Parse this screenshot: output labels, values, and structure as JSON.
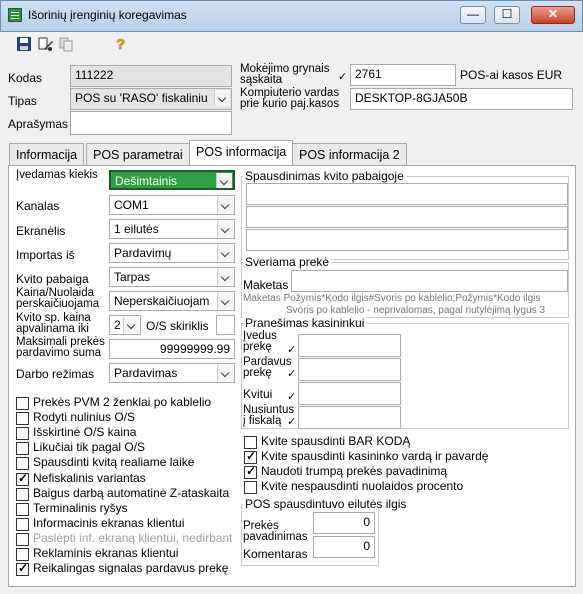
{
  "window": {
    "title": "Išorinių įrenginių koregavimas",
    "btn_min": "—",
    "btn_max": "☐",
    "btn_close": "✕"
  },
  "toolbar": {
    "save_icon": "floppy-disk-icon",
    "edit_icon": "edit-icon",
    "copy_icon": "copy-icon",
    "help_icon": "help-icon",
    "help_glyph": "?"
  },
  "header": {
    "kodas_label": "Kodas",
    "kodas_value": "111222",
    "tipas_label": "Tipas",
    "tipas_value": "POS su 'RASO' fiskaliniu",
    "aprasymas_label": "Aprašymas",
    "aprasymas_value": "",
    "mokejimo_label": "Mokėjimo grynais sąskaita",
    "mokejimo_value": "2761",
    "mokejimo_suffix": "POS-ai kasos EUR",
    "kompiuterio_label": "Kompiuterio vardas prie kurio paj.kasos",
    "kompiuterio_value": "DESKTOP-8GJA50B",
    "check_mark": "✓"
  },
  "tabs": [
    {
      "label": "Informacija"
    },
    {
      "label": "POS parametrai"
    },
    {
      "label": "POS informacija"
    },
    {
      "label": "POS informacija 2"
    }
  ],
  "left": {
    "ivedamas_label": "Įvedamas kiekis",
    "ivedamas_value": "Dešimtainis",
    "kanalas_label": "Kanalas",
    "kanalas_value": "COM1",
    "ekranelis_label": "Ekranėlis",
    "ekranelis_value": "1 eilutės",
    "importas_label": "Importas iš",
    "importas_value": "Pardavimų",
    "kvito_label": "Kvito pabaiga",
    "kvito_value": "Tarpas",
    "kaina_label": "Kaina/Nuolaida perskaičiuojama",
    "kaina_value": "Neperskaičiuojam",
    "apvalinama_label": "Kvito sp. kaina apvalinama iki",
    "apvalinama_value": "2",
    "os_skiriklis": "O/S skiriklis",
    "maks_label": "Maksimali prekės pardavimo suma",
    "maks_value": "99999999.99",
    "darbo_label": "Darbo režimas",
    "darbo_value": "Pardavimas",
    "checkboxes": [
      {
        "label": "Prekės PVM 2 ženklai  po kablelio",
        "checked": false
      },
      {
        "label": "Rodyti nulinius O/S",
        "checked": false
      },
      {
        "label": "Išskirtinė O/S kaina",
        "checked": false
      },
      {
        "label": "Likučiai tik pagal O/S",
        "checked": false
      },
      {
        "label": "Spausdinti kvitą realiame laike",
        "checked": false
      },
      {
        "label": "Nefiskalinis variantas",
        "checked": true
      },
      {
        "label": "Baigus darbą automatinė Z-ataskaita",
        "checked": false
      },
      {
        "label": "Terminalinis ryšys",
        "checked": false
      },
      {
        "label": "Informacinis ekranas klientui",
        "checked": false
      },
      {
        "label": "Paslėpti inf. ekraną klientui, nedirbant",
        "checked": false
      },
      {
        "label": "Reklaminis ekranas klientui",
        "checked": false
      },
      {
        "label": "Reikalingas signalas pardavus prekę",
        "checked": true
      }
    ]
  },
  "right": {
    "spausdinimas_title": "Spausdinimas kvito pabaigoje",
    "sveriama_title": "Sveriama prekė",
    "maketas_label": "Maketas",
    "maketas_value": "",
    "maketas_hint": "Maketas  Požymis*Kodo ilgis#Svoris po kablelio;Požymis*Kodo ilgis",
    "maketas_hint2": "Svoris po kablelio - neprivalomas, pagal nutylėjimą lygus 3",
    "pranesimas_title": "Pranešimas kasininkui",
    "ivedus_label": "Įvedus prekę",
    "pardavus_label": "Pardavus prekę",
    "kvitui_label": "Kvitui",
    "nusiuntus_label": "Nusiuntus į fiskalą",
    "checkboxes": [
      {
        "label": "Kvite spausdinti BAR KODĄ",
        "checked": false
      },
      {
        "label": "Kvite spausdinti kasininko vardą ir pavardę",
        "checked": true
      },
      {
        "label": "Naudoti trumpą prekės pavadinimą",
        "checked": true
      },
      {
        "label": "Kvite nespausdinti nuolaidos procento",
        "checked": false
      }
    ],
    "eilutes_title": "POS spausdintuvo eilutės ilgis",
    "prekes_label": "Prekės pavadinimas",
    "prekes_value": "0",
    "komentaras_label": "Komentaras",
    "komentaras_value": "0"
  }
}
